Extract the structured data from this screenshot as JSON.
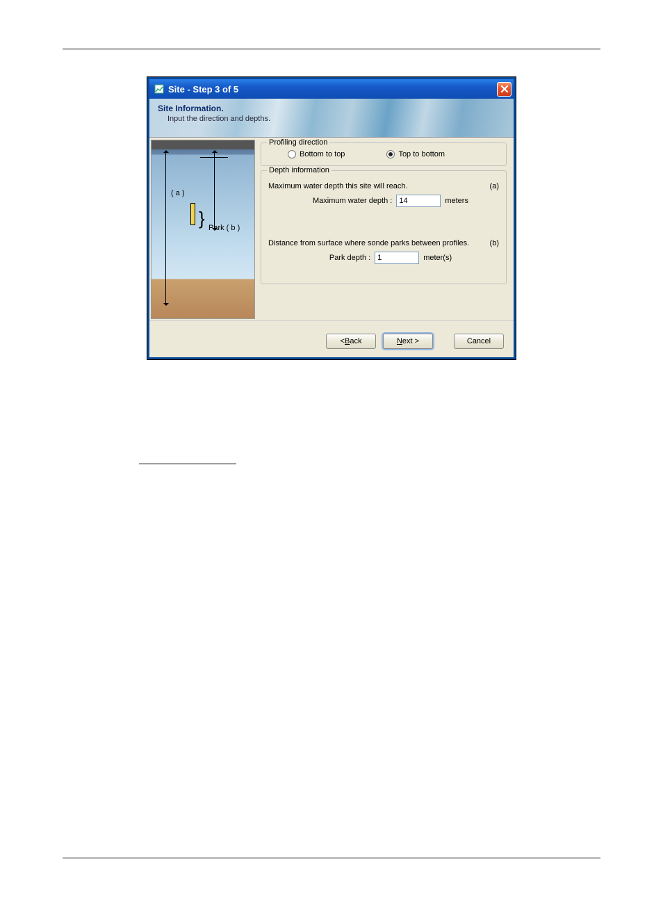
{
  "titlebar": {
    "text": "Site - Step 3 of 5"
  },
  "header": {
    "title": "Site Information.",
    "subtitle": "Input the direction and depths."
  },
  "illustration": {
    "label_a": "( a )",
    "label_b": "Park ( b )"
  },
  "profiling": {
    "legend": "Profiling direction",
    "option_bottom_top": "Bottom to top",
    "option_top_bottom": "Top to bottom",
    "selected": "top_bottom"
  },
  "depth": {
    "legend": "Depth information",
    "max_desc": "Maximum water depth this site will reach.",
    "max_marker": "(a)",
    "max_label": "Maximum water depth :",
    "max_value": "14",
    "max_unit": "meters",
    "park_desc": "Distance from surface where sonde parks between profiles.",
    "park_marker": "(b)",
    "park_label": "Park depth :",
    "park_value": "1",
    "park_unit": "meter(s)"
  },
  "buttons": {
    "back": "Back",
    "next": "Next >",
    "cancel": "Cancel"
  }
}
